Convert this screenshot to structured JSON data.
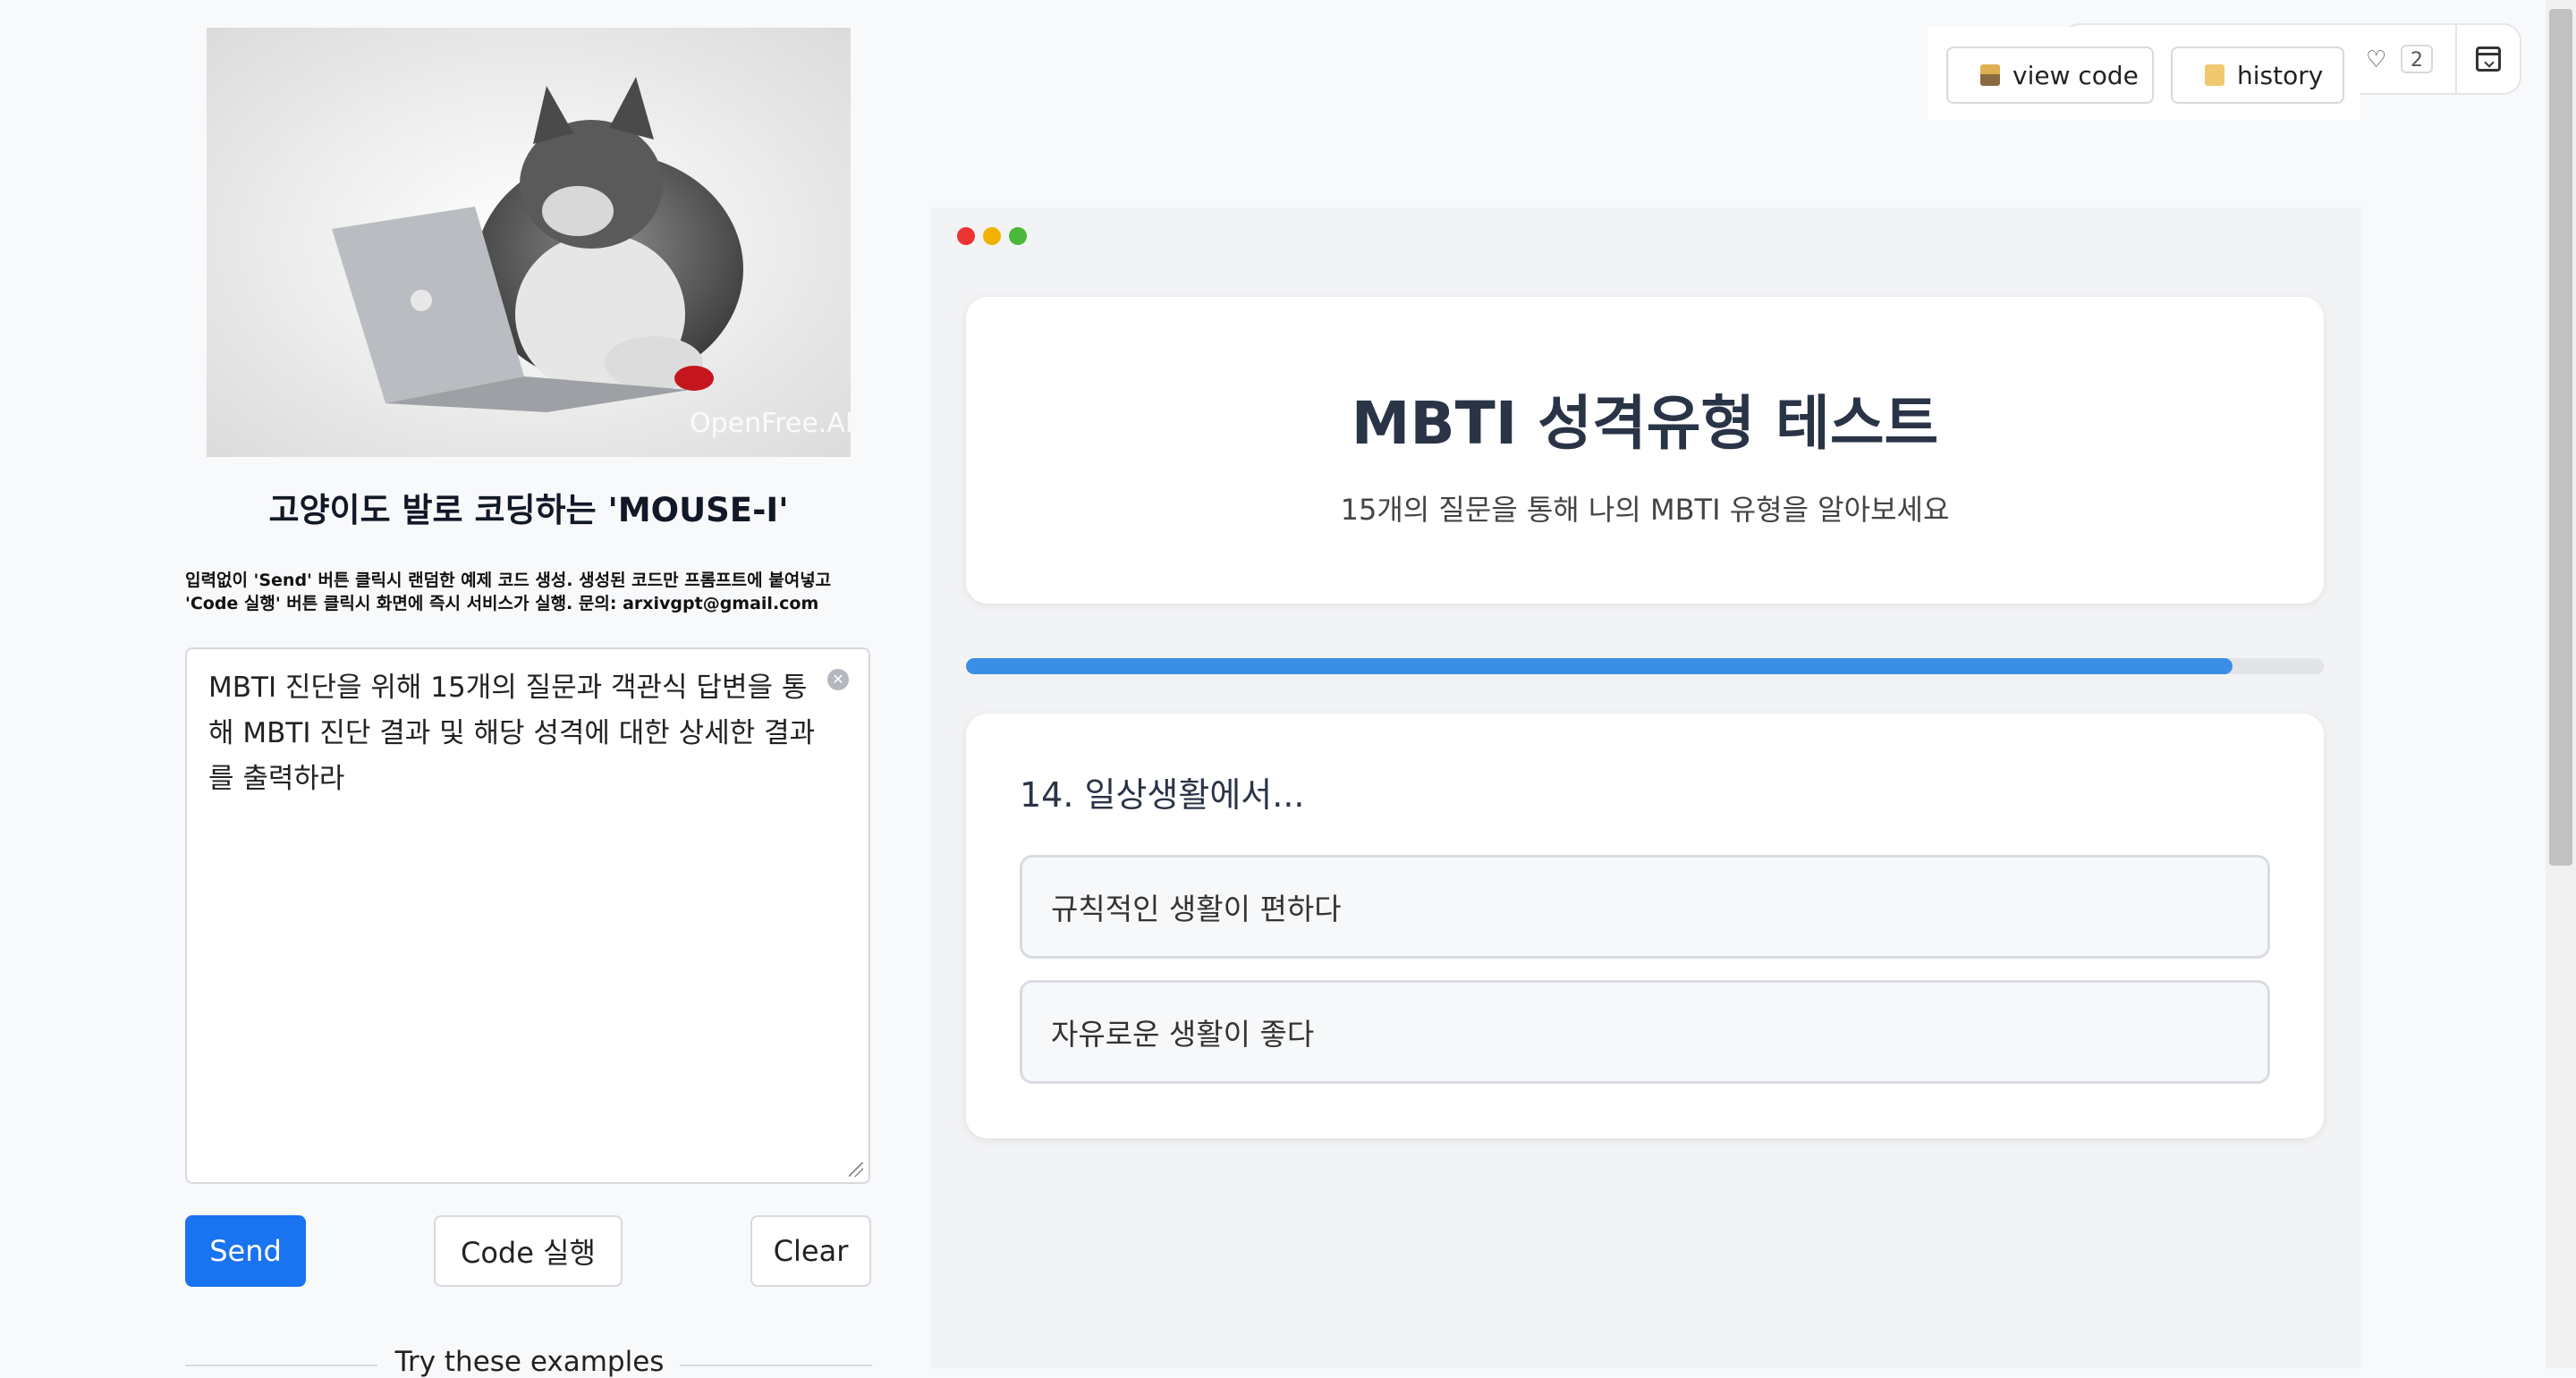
{
  "left_panel": {
    "hero_watermark": "OpenFree.AI",
    "app_title": "고양이도 발로 코딩하는 'MOUSE-I'",
    "description": "입력없이 'Send' 버튼 클릭시 랜덤한 예제 코드 생성. 생성된 코드만 프롬프트에 붙여넣고 'Code 실행' 버튼 클릭시 화면에 즉시 서비스가 실행. 문의: arxivgpt@gmail.com",
    "prompt_value": "MBTI 진단을 위해 15개의 질문과 객관식 답변을 통해 MBTI 진단 결과 및 해당 성격에 대한 상세한 결과를 출력하라",
    "buttons": {
      "send": "Send",
      "run_code": "Code 실행",
      "clear": "Clear"
    },
    "examples_label": "Try these examples"
  },
  "toolbar": {
    "view_code": "view code",
    "history": "history",
    "like_count": "2",
    "icons": [
      "person-icon",
      "scroll-icon",
      "heart-icon",
      "collapse-icon"
    ]
  },
  "preview": {
    "window_dots": [
      "#ee3333",
      "#f2b100",
      "#4ab83a"
    ],
    "title": "MBTI 성격유형 테스트",
    "subtitle": "15개의 질문을 통해 나의 MBTI 유형을 알아보세요",
    "progress_percent": 93.3,
    "question": "14. 일상생활에서...",
    "options": [
      "규칙적인 생활이 편하다",
      "자유로운 생활이 좋다"
    ]
  },
  "colors": {
    "accent": "#1a73f0",
    "progress": "#3b8ee6",
    "title": "#2a3447"
  }
}
